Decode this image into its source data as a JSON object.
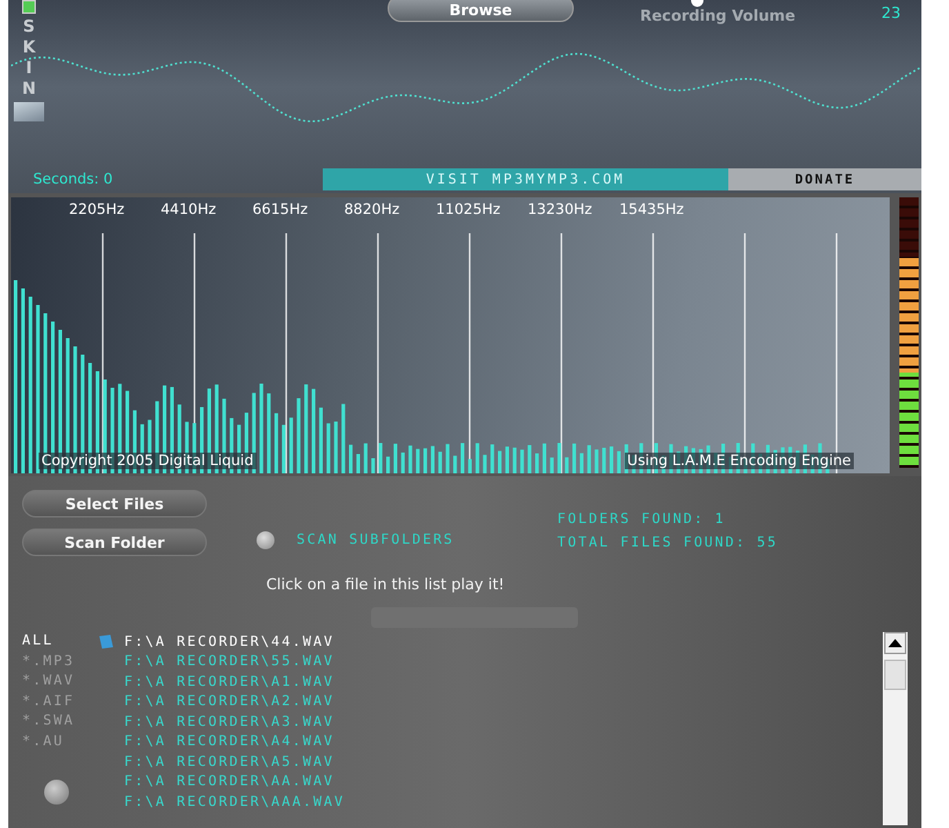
{
  "top_panel": {
    "skin_label": "SKIN",
    "skin_checked": true,
    "browse_button": "Browse",
    "recording_volume": {
      "label": "Recording Volume",
      "reading": "23"
    },
    "seconds": "Seconds: 0",
    "visit_link": "VISIT MP3MYMP3.COM",
    "donate_button": "DONATE"
  },
  "spectrum": {
    "frequency_labels": [
      "2205Hz",
      "4410Hz",
      "6615Hz",
      "8820Hz",
      "11025Hz",
      "13230Hz",
      "15435Hz"
    ],
    "copyright": "Copyright 2005 Digital Liquid",
    "engine_note": "Using L.A.M.E Encoding Engine"
  },
  "vu_meter": {
    "level": 0.78
  },
  "controls": {
    "select_files_button": "Select Files",
    "scan_folder_button": "Scan Folder",
    "scan_subfolders": {
      "label": "SCAN SUBFOLDERS",
      "checked": false
    },
    "folders_found": "FOLDERS FOUND: 1",
    "total_files_found": "TOTAL FILES FOUND: 55",
    "hint": "Click on a file in this list play it!"
  },
  "filters": [
    {
      "label": "ALL",
      "selected": true
    },
    {
      "label": "*.MP3",
      "selected": false
    },
    {
      "label": "*.WAV",
      "selected": false
    },
    {
      "label": "*.AIF",
      "selected": false
    },
    {
      "label": "*.SWA",
      "selected": false
    },
    {
      "label": "*.AU",
      "selected": false
    }
  ],
  "files": [
    {
      "path": "F:\\A RECORDER\\44.WAV",
      "selected": true
    },
    {
      "path": "F:\\A RECORDER\\55.WAV",
      "selected": false
    },
    {
      "path": "F:\\A RECORDER\\A1.WAV",
      "selected": false
    },
    {
      "path": "F:\\A RECORDER\\A2.WAV",
      "selected": false
    },
    {
      "path": "F:\\A RECORDER\\A3.WAV",
      "selected": false
    },
    {
      "path": "F:\\A RECORDER\\A4.WAV",
      "selected": false
    },
    {
      "path": "F:\\A RECORDER\\A5.WAV",
      "selected": false
    },
    {
      "path": "F:\\A RECORDER\\AA.WAV",
      "selected": false
    },
    {
      "path": "F:\\A RECORDER\\AAA.WAV",
      "selected": false
    }
  ]
}
